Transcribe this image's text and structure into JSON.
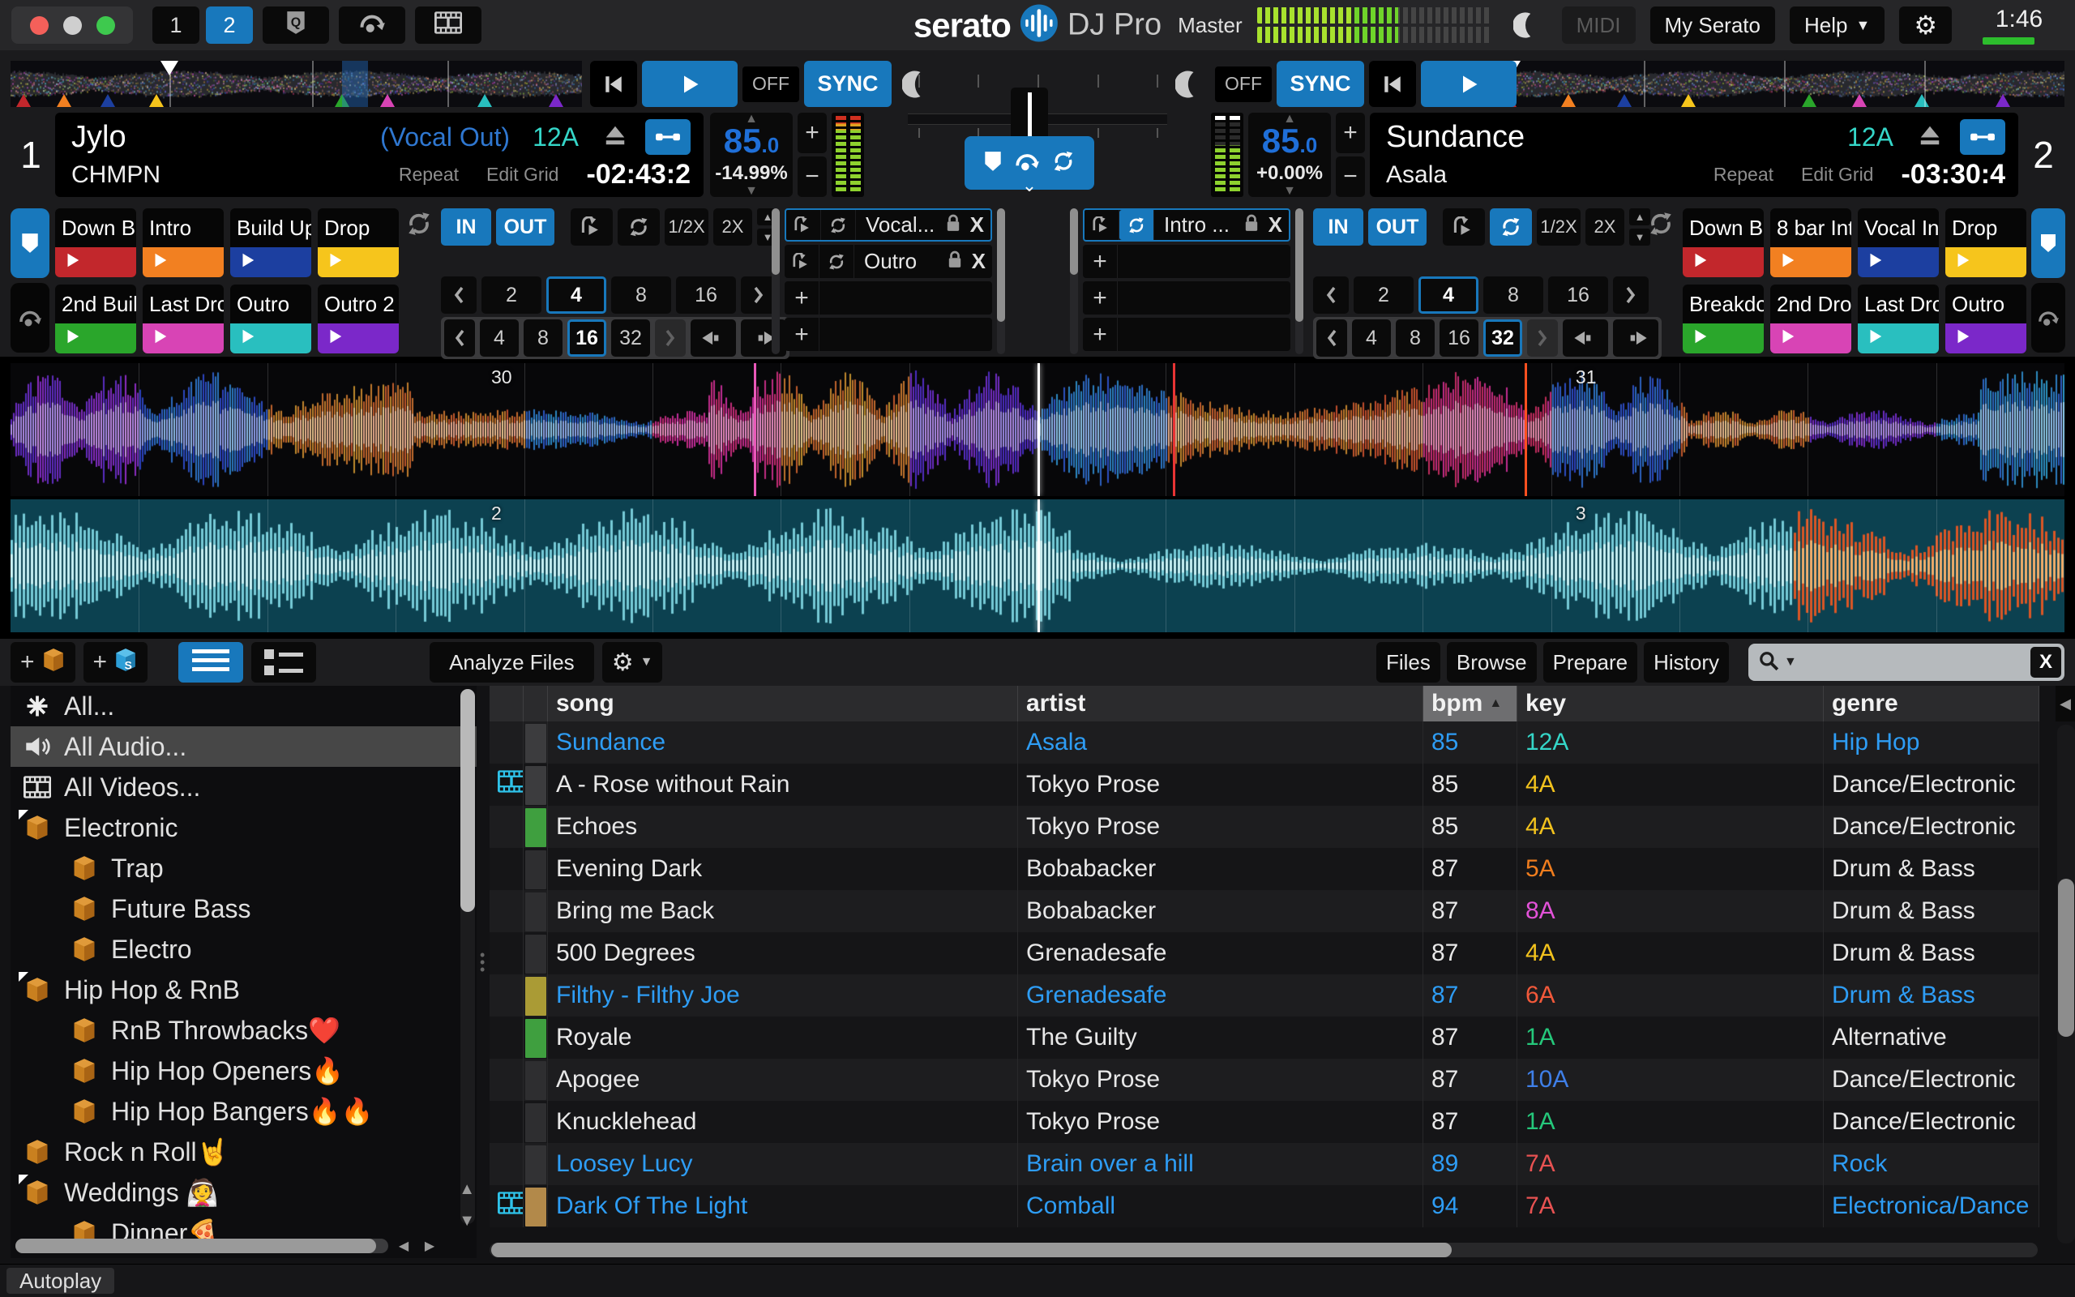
{
  "topbar": {
    "deck_tabs": [
      "1",
      "2"
    ],
    "active_deck_tab": "2",
    "logo": {
      "serato": "serato",
      "product": "DJ Pro"
    },
    "master_label": "Master",
    "midi_label": "MIDI",
    "my_serato_label": "My Serato",
    "help_label": "Help",
    "clock": "1:46"
  },
  "deck1": {
    "number": "1",
    "title": "Jylo",
    "artist": "CHMPN",
    "cue_label": "(Vocal Out)",
    "key": "12A",
    "bpm": "85",
    "bpm_decimal": ".0",
    "pitch": "-14.99%",
    "time": "-02:43:2",
    "repeat_label": "Repeat",
    "edit_grid_label": "Edit Grid",
    "off_label": "OFF",
    "sync_label": "SYNC",
    "pads": [
      {
        "label": "Down B",
        "color": "#c2272c"
      },
      {
        "label": "Intro",
        "color": "#f28021"
      },
      {
        "label": "Build Up",
        "color": "#1c3fa0"
      },
      {
        "label": "Drop",
        "color": "#f6c51c"
      },
      {
        "label": "2nd Buil",
        "color": "#2aa62b"
      },
      {
        "label": "Last Drc",
        "color": "#d844b5"
      },
      {
        "label": "Outro",
        "color": "#29bfbf"
      },
      {
        "label": "Outro 2",
        "color": "#7b28c9"
      }
    ],
    "loop": {
      "in": "IN",
      "out": "OUT",
      "half": "1/2X",
      "double": "2X",
      "auto_values": [
        "2",
        "4",
        "8",
        "16"
      ],
      "auto_active": "4",
      "jump_values": [
        "4",
        "8",
        "16",
        "32"
      ],
      "jump_active": "16"
    },
    "saved_loops": [
      {
        "label": "Vocal...",
        "selected": true,
        "loop_active": false
      },
      {
        "label": "Outro",
        "selected": false,
        "loop_active": false
      }
    ]
  },
  "deck2": {
    "number": "2",
    "title": "Sundance",
    "artist": "Asala",
    "key": "12A",
    "bpm": "85",
    "bpm_decimal": ".0",
    "pitch": "+0.00%",
    "time": "-03:30:4",
    "repeat_label": "Repeat",
    "edit_grid_label": "Edit Grid",
    "off_label": "OFF",
    "sync_label": "SYNC",
    "pads": [
      {
        "label": "Down B",
        "color": "#c2272c"
      },
      {
        "label": "8 bar Int",
        "color": "#f28021"
      },
      {
        "label": "Vocal In",
        "color": "#1c3fa0"
      },
      {
        "label": "Drop",
        "color": "#f6c51c"
      },
      {
        "label": "Breakdo",
        "color": "#2aa62b"
      },
      {
        "label": "2nd Dro",
        "color": "#d844b5"
      },
      {
        "label": "Last Drc",
        "color": "#29bfbf"
      },
      {
        "label": "Outro",
        "color": "#7b28c9"
      }
    ],
    "loop": {
      "in": "IN",
      "out": "OUT",
      "half": "1/2X",
      "double": "2X",
      "auto_values": [
        "2",
        "4",
        "8",
        "16"
      ],
      "auto_active": "4",
      "jump_values": [
        "4",
        "8",
        "16",
        "32"
      ],
      "jump_active": "32"
    },
    "saved_loops": [
      {
        "label": "Intro ...",
        "selected": true,
        "loop_active": true
      }
    ]
  },
  "waveforms": {
    "top_bar_numbers": [
      "30",
      "31"
    ],
    "bottom_bar_numbers": [
      "2",
      "3"
    ]
  },
  "library": {
    "toolbar": {
      "analyze": "Analyze Files",
      "tabs": [
        "Files",
        "Browse",
        "Prepare",
        "History"
      ]
    },
    "search": {
      "placeholder": ""
    },
    "autoplay_label": "Autoplay",
    "columns": [
      "song",
      "artist",
      "bpm",
      "key",
      "genre"
    ],
    "sort_column": "bpm",
    "sidebar": [
      {
        "label": "All...",
        "icon": "asterisk-icon",
        "indent": 0,
        "selected": false,
        "expanded": false
      },
      {
        "label": "All Audio...",
        "icon": "audio-icon",
        "indent": 0,
        "selected": true,
        "expanded": false
      },
      {
        "label": "All Videos...",
        "icon": "video-icon",
        "indent": 0,
        "selected": false,
        "expanded": false
      },
      {
        "label": "Electronic",
        "icon": "crate-icon",
        "indent": 0,
        "selected": false,
        "expanded": true
      },
      {
        "label": "Trap",
        "icon": "crate-icon",
        "indent": 1,
        "selected": false,
        "expanded": false
      },
      {
        "label": "Future Bass",
        "icon": "crate-icon",
        "indent": 1,
        "selected": false,
        "expanded": false
      },
      {
        "label": "Electro",
        "icon": "crate-icon",
        "indent": 1,
        "selected": false,
        "expanded": false
      },
      {
        "label": "Hip Hop & RnB",
        "icon": "crate-icon",
        "indent": 0,
        "selected": false,
        "expanded": true
      },
      {
        "label": "RnB Throwbacks❤️",
        "icon": "crate-icon",
        "indent": 1,
        "selected": false,
        "expanded": false
      },
      {
        "label": "Hip Hop Openers🔥",
        "icon": "crate-icon",
        "indent": 1,
        "selected": false,
        "expanded": false
      },
      {
        "label": "Hip Hop Bangers🔥🔥",
        "icon": "crate-icon",
        "indent": 1,
        "selected": false,
        "expanded": false
      },
      {
        "label": "Rock n Roll🤘",
        "icon": "crate-icon",
        "indent": 0,
        "selected": false,
        "expanded": false
      },
      {
        "label": "Weddings 👰",
        "icon": "crate-icon",
        "indent": 0,
        "selected": false,
        "expanded": true
      },
      {
        "label": "Dinner🍕",
        "icon": "crate-icon",
        "indent": 1,
        "selected": false,
        "expanded": false
      }
    ],
    "rows": [
      {
        "song": "Sundance",
        "artist": "Asala",
        "bpm": "85",
        "key": "12A",
        "key_color": "#35d6c8",
        "genre": "Hip Hop",
        "highlight": true,
        "strip": "#3c3c3e",
        "film": false
      },
      {
        "song": "A - Rose without Rain",
        "artist": "Tokyo Prose",
        "bpm": "85",
        "key": "4A",
        "key_color": "#f2c21d",
        "genre": "Dance/Electronic",
        "highlight": false,
        "strip": "#3c3c3e",
        "film": true
      },
      {
        "song": "Echoes",
        "artist": "Tokyo Prose",
        "bpm": "85",
        "key": "4A",
        "key_color": "#f2c21d",
        "genre": "Dance/Electronic",
        "highlight": false,
        "strip": "#3f9f3f",
        "film": false
      },
      {
        "song": "Evening Dark",
        "artist": "Bobabacker",
        "bpm": "87",
        "key": "5A",
        "key_color": "#f07d1e",
        "genre": "Drum & Bass",
        "highlight": false,
        "strip": "#2e2e30",
        "film": false
      },
      {
        "song": "Bring me Back",
        "artist": "Bobabacker",
        "bpm": "87",
        "key": "8A",
        "key_color": "#e352d8",
        "genre": "Drum & Bass",
        "highlight": false,
        "strip": "#2e2e30",
        "film": false
      },
      {
        "song": "500 Degrees",
        "artist": "Grenadesafe",
        "bpm": "87",
        "key": "4A",
        "key_color": "#f2c21d",
        "genre": "Drum & Bass",
        "highlight": false,
        "strip": "#2e2e30",
        "film": false
      },
      {
        "song": "Filthy - Filthy Joe",
        "artist": "Grenadesafe",
        "bpm": "87",
        "key": "6A",
        "key_color": "#f2593a",
        "genre": "Drum & Bass",
        "highlight": true,
        "strip": "#aa9b35",
        "film": false
      },
      {
        "song": "Royale",
        "artist": "The Guilty",
        "bpm": "87",
        "key": "1A",
        "key_color": "#25c87b",
        "genre": "Alternative",
        "highlight": false,
        "strip": "#3f9f3f",
        "film": false
      },
      {
        "song": "Apogee",
        "artist": "Tokyo Prose",
        "bpm": "87",
        "key": "10A",
        "key_color": "#3f7fe8",
        "genre": "Dance/Electronic",
        "highlight": false,
        "strip": "#2e2e30",
        "film": false
      },
      {
        "song": "Knucklehead",
        "artist": "Tokyo Prose",
        "bpm": "87",
        "key": "1A",
        "key_color": "#25c87b",
        "genre": "Dance/Electronic",
        "highlight": false,
        "strip": "#2e2e30",
        "film": false
      },
      {
        "song": "Loosey Lucy",
        "artist": "Brain over a hill",
        "bpm": "89",
        "key": "7A",
        "key_color": "#e85252",
        "genre": "Rock",
        "highlight": true,
        "strip": "#323234",
        "film": false
      },
      {
        "song": "Dark Of The Light",
        "artist": "Comball",
        "bpm": "94",
        "key": "7A",
        "key_color": "#e85252",
        "genre": "Electronica/Dance",
        "highlight": true,
        "strip": "#b2894a",
        "film": true
      }
    ]
  },
  "colors": {
    "accent_blue": "#1878bc",
    "bpm_blue": "#1f6fd8",
    "link_blue": "#2e9df5",
    "key_cyan": "#35d6c8"
  }
}
